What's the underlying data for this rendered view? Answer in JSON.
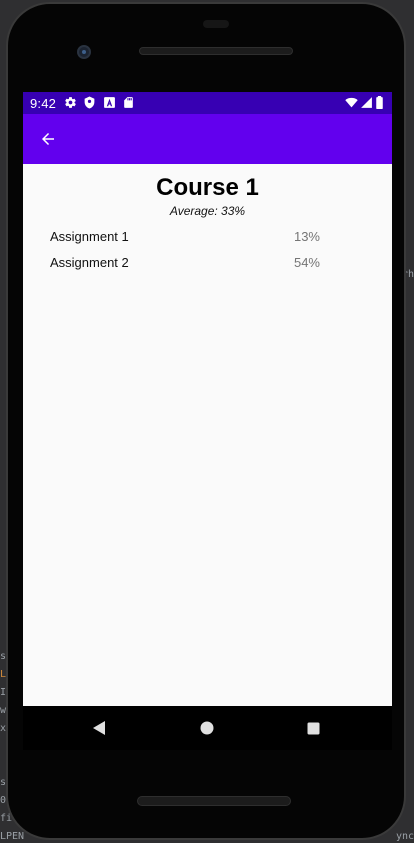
{
  "status_bar": {
    "time": "9:42",
    "icons_left": [
      "gear-icon",
      "shield-icon",
      "a-icon",
      "sd-card-icon"
    ],
    "icons_right": [
      "wifi-icon",
      "signal-icon",
      "battery-icon"
    ]
  },
  "app_bar": {
    "back_icon": "arrow-left-icon",
    "color": "#6200ee",
    "status_color": "#3700b3"
  },
  "course": {
    "title": "Course 1",
    "average": "Average: 33%"
  },
  "assignments": [
    {
      "name": "Assignment 1",
      "score": "13%"
    },
    {
      "name": "Assignment 2",
      "score": "54%"
    }
  ],
  "nav_bar": {
    "buttons": [
      "back-triangle-icon",
      "home-circle-icon",
      "recents-square-icon"
    ]
  },
  "backdrop_left": [
    "s",
    "L",
    "I",
    "w",
    "x",
    "s",
    "0",
    "fi",
    "LPEN"
  ],
  "backdrop_right": [
    "rh",
    "ync"
  ]
}
